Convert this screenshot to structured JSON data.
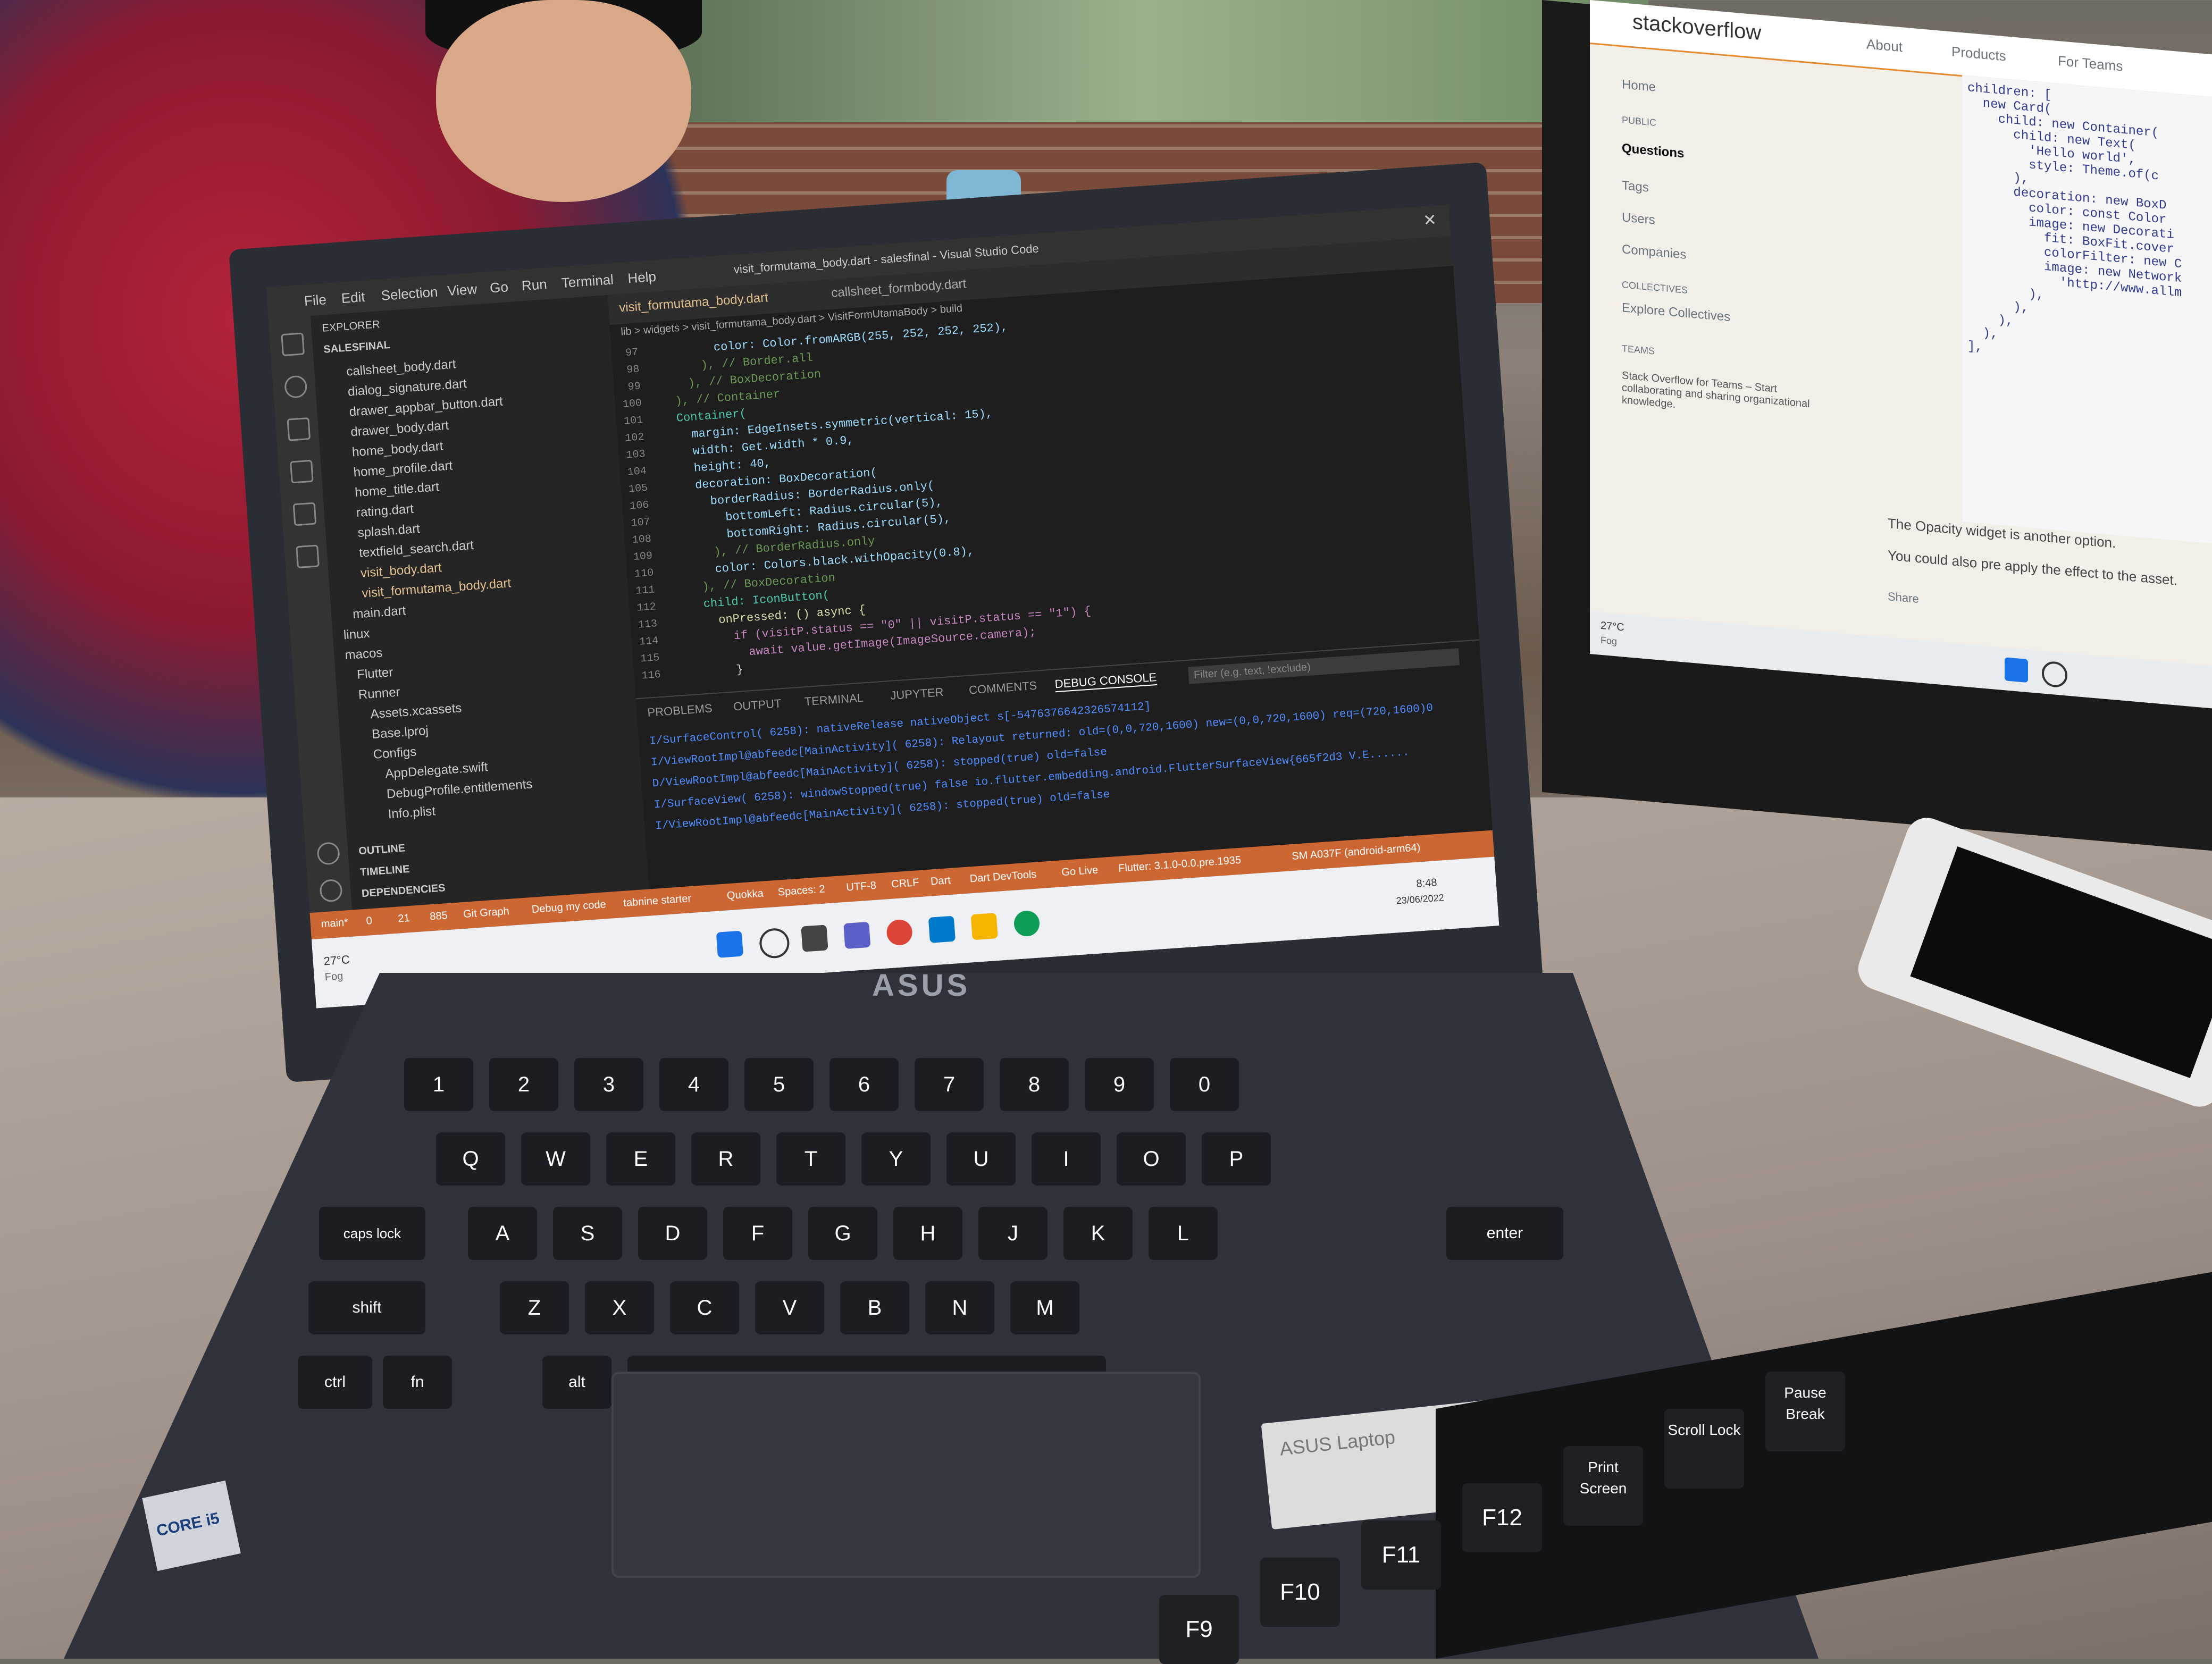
{
  "vscode": {
    "window_title": "visit_formutama_body.dart - salesfinal - Visual Studio Code",
    "menu": [
      "File",
      "Edit",
      "Selection",
      "View",
      "Go",
      "Run",
      "Terminal",
      "Help"
    ],
    "explorer_label": "EXPLORER",
    "project": "SALESFINAL",
    "files": [
      "callsheet_body.dart",
      "dialog_signature.dart",
      "drawer_appbar_button.dart",
      "drawer_body.dart",
      "home_body.dart",
      "home_profile.dart",
      "home_title.dart",
      "rating.dart",
      "splash.dart",
      "textfield_search.dart",
      "visit_body.dart",
      "visit_formutama_body.dart",
      "main.dart",
      "linux",
      "macos",
      "Flutter",
      "Runner",
      "Assets.xcassets",
      "Base.lproj",
      "Configs",
      "AppDelegate.swift",
      "DebugProfile.entitlements",
      "Info.plist"
    ],
    "sections": [
      "OUTLINE",
      "TIMELINE",
      "DEPENDENCIES"
    ],
    "tabs": [
      "visit_formutama_body.dart",
      "callsheet_formbody.dart"
    ],
    "breadcrumb": "lib > widgets > visit_formutama_body.dart > VisitFormUtamaBody > build",
    "line_numbers": [
      "97",
      "98",
      "99",
      "100",
      "101",
      "102",
      "103",
      "104",
      "105",
      "106",
      "107",
      "108",
      "109",
      "110",
      "111",
      "112",
      "113",
      "114",
      "115",
      "116"
    ],
    "code": [
      "          color: Color.fromARGB(255, 252, 252, 252),",
      "        ), // Border.all",
      "      ), // BoxDecoration",
      "    ), // Container",
      "    Container(",
      "      margin: EdgeInsets.symmetric(vertical: 15),",
      "      width: Get.width * 0.9,",
      "      height: 40,",
      "      decoration: BoxDecoration(",
      "        borderRadius: BorderRadius.only(",
      "          bottomLeft: Radius.circular(5),",
      "          bottomRight: Radius.circular(5),",
      "        ), // BorderRadius.only",
      "        color: Colors.black.withOpacity(0.8),",
      "      ), // BoxDecoration",
      "      child: IconButton(",
      "        onPressed: () async {",
      "          if (visitP.status == \"0\" || visitP.status == \"1\") {",
      "            await value.getImage(ImageSource.camera);",
      "          }"
    ],
    "panel_tabs": [
      "PROBLEMS",
      "OUTPUT",
      "TERMINAL",
      "JUPYTER",
      "COMMENTS",
      "DEBUG CONSOLE"
    ],
    "filter_placeholder": "Filter (e.g. text, !exclude)",
    "console": [
      "I/SurfaceControl( 6258): nativeRelease nativeObject s[-5476376642326574112]",
      "I/ViewRootImpl@abfeedc[MainActivity]( 6258): Relayout returned: old=(0,0,720,1600) new=(0,0,720,1600) req=(720,1600)0",
      "D/ViewRootImpl@abfeedc[MainActivity]( 6258): stopped(true) old=false",
      "I/SurfaceView( 6258): windowStopped(true) false io.flutter.embedding.android.FlutterSurfaceView{665f2d3 V.E......",
      "I/ViewRootImpl@abfeedc[MainActivity]( 6258): stopped(true) old=false"
    ],
    "status_items": [
      "main*",
      "0",
      "21",
      "885",
      "Git Graph",
      "Debug my code",
      "tabnine starter",
      "Quokka",
      "Spaces: 2",
      "UTF-8",
      "CRLF",
      "Dart",
      "Dart DevTools",
      "Go Live",
      "Flutter: 3.1.0-0.0.pre.1935",
      "SM A037F (android-arm64)"
    ],
    "weather": "27°C",
    "weather_desc": "Fog",
    "clock_time": "8:48",
    "clock_date": "23/06/2022"
  },
  "stackoverflow": {
    "logo": "stackoverflow",
    "nav": [
      "About",
      "Products",
      "For Teams"
    ],
    "sidebar": [
      "Home",
      "PUBLIC",
      "Questions",
      "Tags",
      "Users",
      "Companies",
      "COLLECTIVES",
      "Explore Collectives",
      "TEAMS"
    ],
    "teams_promo": "Stack Overflow for Teams – Start collaborating and sharing organizational knowledge.",
    "code": "children: [\n  new Card(\n    child: new Container(\n      child: new Text(\n        'Hello world',\n        style: Theme.of(c\n      ),\n      decoration: new BoxD\n        color: const Color\n        image: new Decorati\n          fit: BoxFit.cover\n          colorFilter: new C\n          image: new Network\n            'http://www.allm\n        ),\n      ),\n    ),\n  ),\n],",
    "text1": "The Opacity widget is another option.",
    "text2": "You could also pre apply the effect to the asset.",
    "share": "Share",
    "weather": "27°C",
    "weather_desc": "Fog"
  },
  "laptop": {
    "brand": "ASUS",
    "sticker": "ASUS Laptop",
    "keys_row1": [
      "1",
      "2",
      "3",
      "4",
      "5",
      "6",
      "7",
      "8",
      "9",
      "0"
    ],
    "keys_row2": [
      "Q",
      "W",
      "E",
      "R",
      "T",
      "Y",
      "U",
      "I",
      "O",
      "P"
    ],
    "keys_row3": [
      "A",
      "S",
      "D",
      "F",
      "G",
      "H",
      "J",
      "K",
      "L"
    ],
    "keys_row4": [
      "Z",
      "X",
      "C",
      "V",
      "B",
      "N",
      "M"
    ],
    "special": [
      "caps lock",
      "shift",
      "ctrl",
      "fn",
      "alt",
      "enter"
    ],
    "intel": "CORE i5"
  },
  "external_keyboard": {
    "keys": [
      "F9",
      "F10",
      "F11",
      "F12",
      "Print Screen",
      "Scroll Lock",
      "Pause Break"
    ]
  },
  "colors": {
    "vscode_status": "#cc6633",
    "vscode_bg": "#1e1e1e",
    "so_accent": "#e48a2c"
  }
}
